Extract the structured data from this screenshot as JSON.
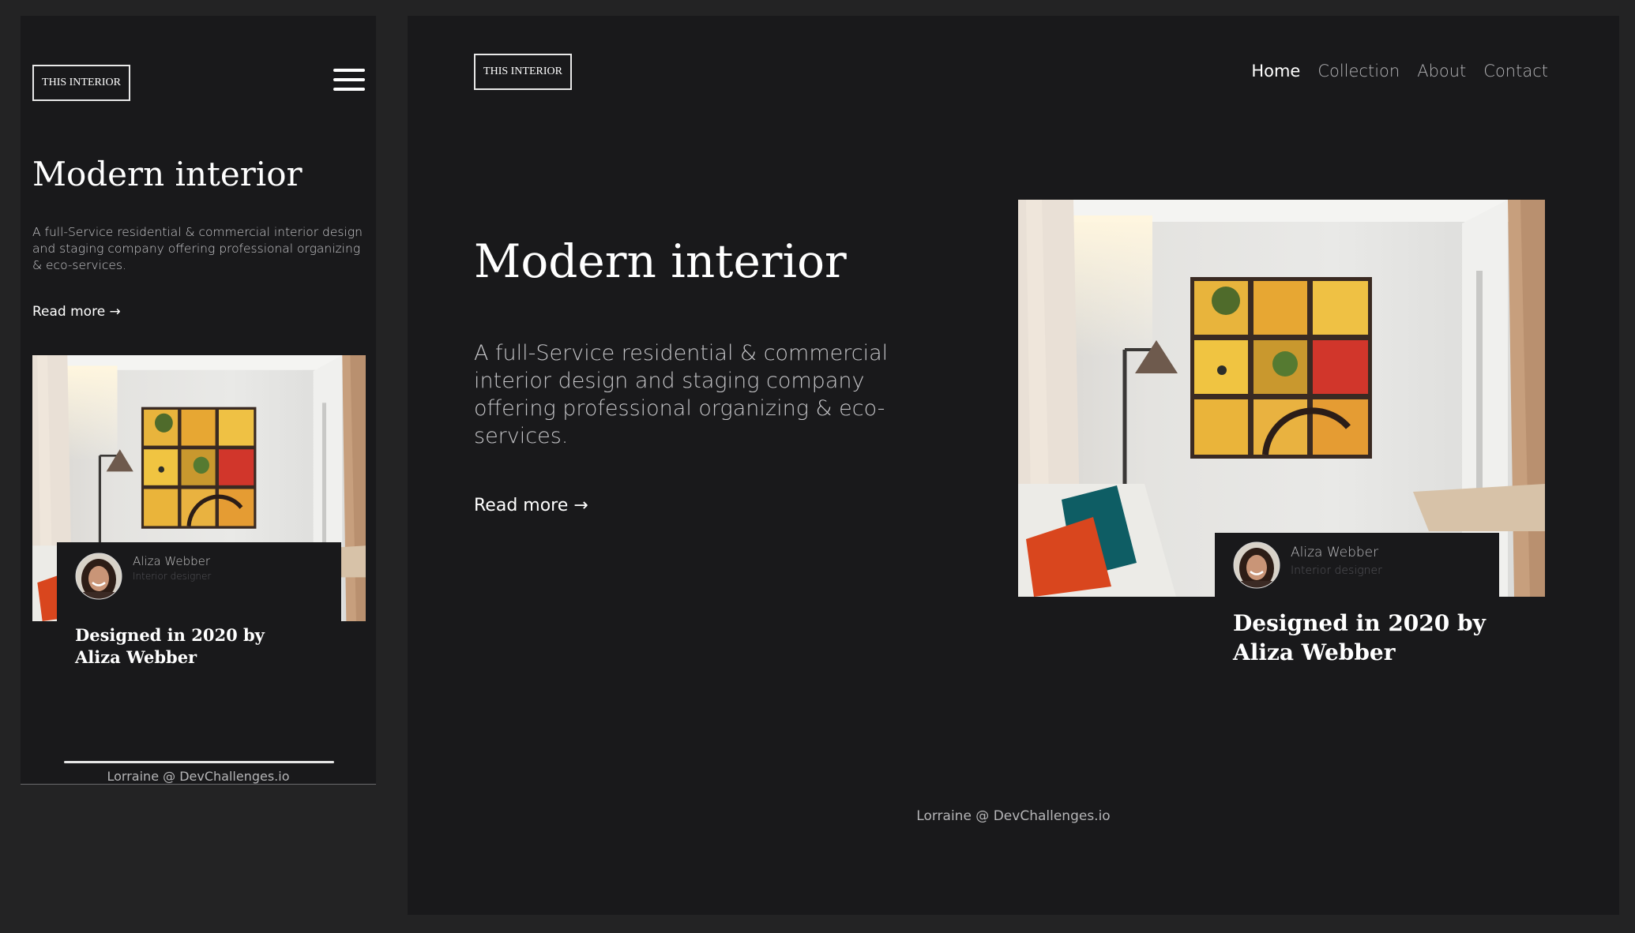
{
  "brand": {
    "logo_text": "THIS INTERIOR"
  },
  "nav": {
    "items": [
      {
        "label": "Home",
        "active": true
      },
      {
        "label": "Collection",
        "active": false
      },
      {
        "label": "About",
        "active": false
      },
      {
        "label": "Contact",
        "active": false
      }
    ]
  },
  "hero": {
    "title": "Modern interior",
    "description": "A full-Service residential & commercial interior design and staging company offering professional organizing & eco-services.",
    "read_more_label": "Read more →"
  },
  "designer_card": {
    "name": "Aliza Webber",
    "role": "Interior designer",
    "caption": "Designed in 2020 by Aliza Webber"
  },
  "footer": {
    "text": "Lorraine @ DevChallenges.io"
  },
  "icons": {
    "menu": "hamburger-menu-icon",
    "arrow": "arrow-right-icon"
  },
  "colors": {
    "page_background": "#232324",
    "panel_background": "#19191b",
    "text_primary": "#ffffff",
    "text_muted": "#b5b5b8",
    "text_faint": "#55555a"
  }
}
